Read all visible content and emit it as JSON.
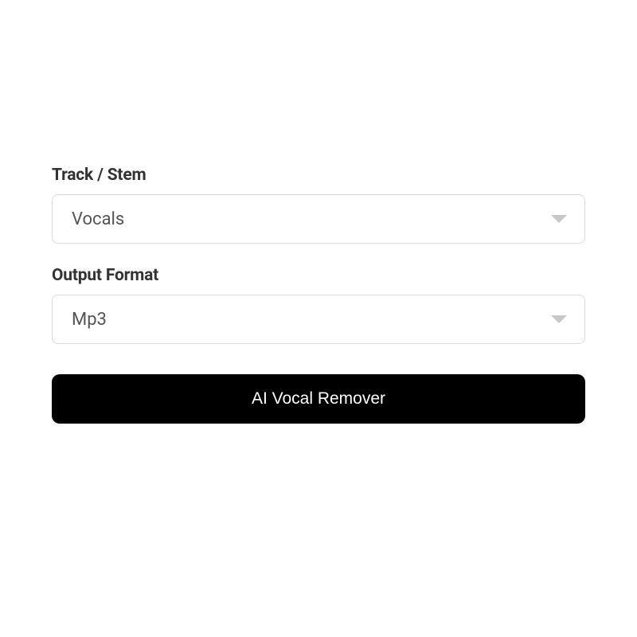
{
  "form": {
    "track_stem": {
      "label": "Track / Stem",
      "value": "Vocals"
    },
    "output_format": {
      "label": "Output Format",
      "value": "Mp3"
    },
    "submit_label": "AI Vocal Remover"
  }
}
